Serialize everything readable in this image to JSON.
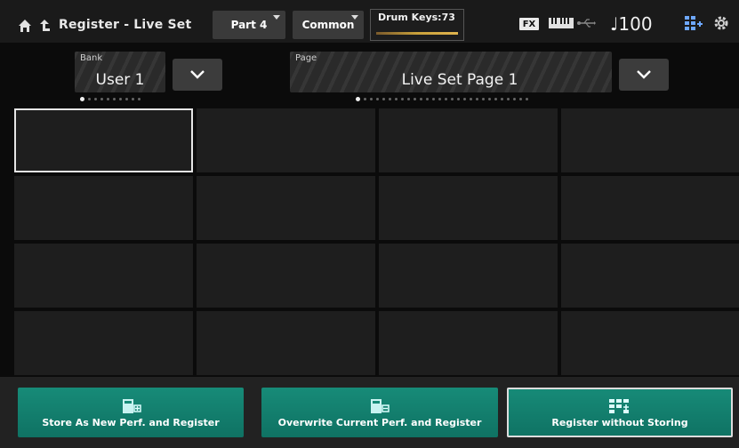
{
  "header": {
    "title": "Register - Live Set",
    "part_tab": "Part 4",
    "common_tab": "Common",
    "drum_keys": "Drum Keys:73",
    "fx_label": "FX",
    "tempo": "♩100"
  },
  "bank": {
    "caption": "Bank",
    "value": "User 1"
  },
  "page": {
    "caption": "Page",
    "value": "Live Set Page  1"
  },
  "slots": {
    "rows": 4,
    "cols": 4,
    "selected_index": 0
  },
  "actions": {
    "store_new": "Store As New Perf. and Register",
    "overwrite": "Overwrite Current Perf. and Register",
    "register_without": "Register without Storing"
  },
  "colors": {
    "accent": "#178b78",
    "background": "#0b0b0b",
    "slot": "#1e1e1e"
  }
}
